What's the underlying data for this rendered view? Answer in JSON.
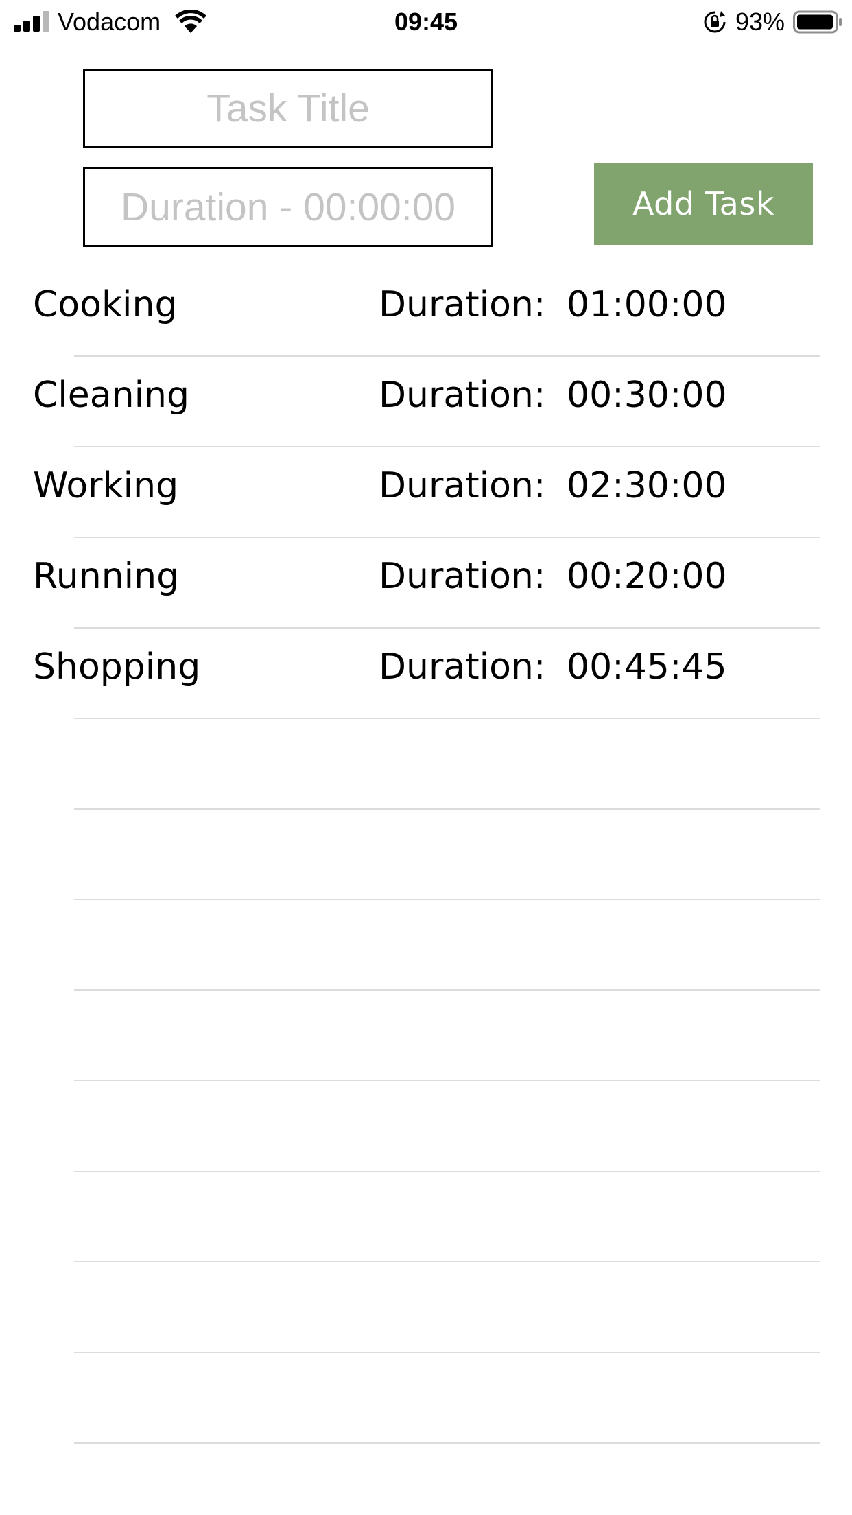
{
  "status_bar": {
    "carrier": "Vodacom",
    "time": "09:45",
    "battery_percent": "93%",
    "signal_icon": "cellular-signal-icon",
    "wifi_icon": "wifi-icon",
    "rotation_lock_icon": "rotation-lock-icon",
    "battery_icon": "battery-icon",
    "battery_level": 0.93
  },
  "form": {
    "title_value": "",
    "title_placeholder": "Task Title",
    "duration_value": "",
    "duration_placeholder": "Duration - 00:00:00",
    "add_button_label": "Add Task",
    "add_button_color": "#81a46f"
  },
  "tasks": [
    {
      "name": "Cooking",
      "duration_label": "Duration:",
      "duration": "01:00:00"
    },
    {
      "name": "Cleaning",
      "duration_label": "Duration:",
      "duration": "00:30:00"
    },
    {
      "name": "Working",
      "duration_label": "Duration:",
      "duration": "02:30:00"
    },
    {
      "name": "Running",
      "duration_label": "Duration:",
      "duration": "00:20:00"
    },
    {
      "name": "Shopping",
      "duration_label": "Duration:",
      "duration": "00:45:45"
    }
  ]
}
